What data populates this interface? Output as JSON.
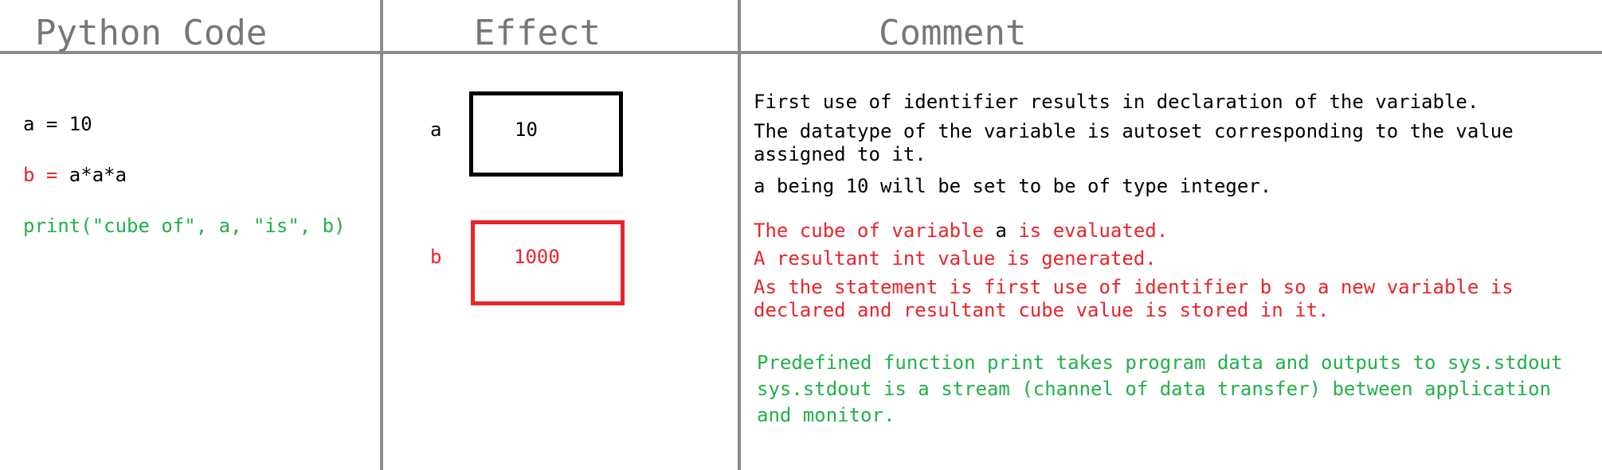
{
  "headers": {
    "code": "Python Code",
    "effect": "Effect",
    "comment": "Comment"
  },
  "code": {
    "line1": "a = 10",
    "line2_var": "b =",
    "line2_expr": " a*a*a",
    "line3": "print(\"cube of\", a, \"is\", b)"
  },
  "effect": {
    "var_a": {
      "name": "a",
      "value": "10"
    },
    "var_b": {
      "name": "b",
      "value": "1000"
    }
  },
  "comments": {
    "block1": [
      "First use of identifier results in declaration of the variable.",
      "The datatype of the variable is autoset corresponding to the value",
      "assigned to it.",
      "a being 10 will be set to be of type integer."
    ],
    "block2_line1_pre": "The cube of variable ",
    "block2_line1_var": "a",
    "block2_line1_post": " is evaluated.",
    "block2": [
      "A resultant int value is generated.",
      "As the statement is first use of identifier b so a new variable is",
      "declared and resultant cube value is stored in it."
    ],
    "block3": [
      "Predefined function print takes program data and outputs to sys.stdout",
      "sys.stdout is a stream (channel of data transfer) between application",
      "and monitor."
    ]
  },
  "colors": {
    "line": "#8a8a8a",
    "header": "#777777",
    "red": "#e8242b",
    "green": "#22b04a",
    "black": "#000000"
  }
}
